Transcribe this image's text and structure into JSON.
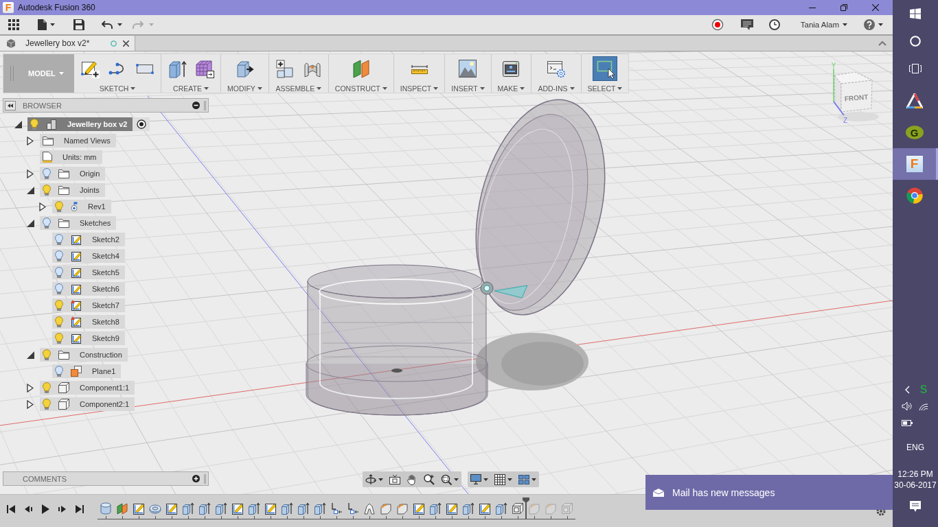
{
  "window": {
    "logo": "F",
    "title": "Autodesk Fusion 360"
  },
  "quick_access": {
    "undo_disabled": false,
    "redo_disabled": true,
    "user": "Tania Alam"
  },
  "document_tab": {
    "title": "Jewellery box v2*"
  },
  "toolbar": {
    "workspace": "MODEL",
    "groups": [
      {
        "label": "SKETCH",
        "active": false
      },
      {
        "label": "CREATE",
        "active": false
      },
      {
        "label": "MODIFY",
        "active": false
      },
      {
        "label": "ASSEMBLE",
        "active": false
      },
      {
        "label": "CONSTRUCT",
        "active": false
      },
      {
        "label": "INSPECT",
        "active": false
      },
      {
        "label": "INSERT",
        "active": false
      },
      {
        "label": "MAKE",
        "active": false
      },
      {
        "label": "ADD-INS",
        "active": false
      },
      {
        "label": "SELECT",
        "active": true
      }
    ]
  },
  "browser": {
    "title": "BROWSER",
    "tree": [
      {
        "label": "Jewellery box v2",
        "kind": "root",
        "visible": true,
        "expanded": true,
        "active": true,
        "children": [
          {
            "label": "Named Views",
            "kind": "folder",
            "expanded": false
          },
          {
            "label": "Units: mm",
            "kind": "units"
          },
          {
            "label": "Origin",
            "kind": "folder",
            "visible": false,
            "expanded": false
          },
          {
            "label": "Joints",
            "kind": "folder",
            "visible": true,
            "expanded": true,
            "children": [
              {
                "label": "Rev1",
                "kind": "joint",
                "visible": true,
                "expanded": false
              }
            ]
          },
          {
            "label": "Sketches",
            "kind": "folder",
            "visible": false,
            "expanded": true,
            "children": [
              {
                "label": "Sketch2",
                "kind": "sketch",
                "visible": false,
                "warning": false
              },
              {
                "label": "Sketch4",
                "kind": "sketch",
                "visible": false,
                "warning": false
              },
              {
                "label": "Sketch5",
                "kind": "sketch",
                "visible": false,
                "warning": false
              },
              {
                "label": "Sketch6",
                "kind": "sketch",
                "visible": false,
                "warning": false
              },
              {
                "label": "Sketch7",
                "kind": "sketch",
                "visible": true,
                "warning": true
              },
              {
                "label": "Sketch8",
                "kind": "sketch",
                "visible": true,
                "warning": true
              },
              {
                "label": "Sketch9",
                "kind": "sketch",
                "visible": true,
                "warning": false
              }
            ]
          },
          {
            "label": "Construction",
            "kind": "folder",
            "visible": true,
            "expanded": true,
            "children": [
              {
                "label": "Plane1",
                "kind": "plane",
                "visible": false
              }
            ]
          },
          {
            "label": "Component1:1",
            "kind": "component",
            "visible": true,
            "expanded": false
          },
          {
            "label": "Component2:1",
            "kind": "component",
            "visible": true,
            "expanded": false
          }
        ]
      }
    ]
  },
  "viewport": {
    "view_cube": {
      "face_label": "FRONT",
      "axis_labels": [
        "Y",
        "Z"
      ]
    }
  },
  "comments": {
    "title": "COMMENTS"
  },
  "timeline": {
    "items": [
      {
        "kind": "cylinder",
        "rolled_back": false
      },
      {
        "kind": "planes",
        "rolled_back": false
      },
      {
        "kind": "sketch",
        "rolled_back": false
      },
      {
        "kind": "ring",
        "rolled_back": false
      },
      {
        "kind": "sketch",
        "rolled_back": false
      },
      {
        "kind": "extrude",
        "rolled_back": false
      },
      {
        "kind": "extrude",
        "rolled_back": false
      },
      {
        "kind": "extrude",
        "rolled_back": false
      },
      {
        "kind": "sketch",
        "rolled_back": false
      },
      {
        "kind": "extrude",
        "rolled_back": false
      },
      {
        "kind": "sketch",
        "rolled_back": false
      },
      {
        "kind": "extrude",
        "rolled_back": false
      },
      {
        "kind": "extrude",
        "rolled_back": false
      },
      {
        "kind": "extrude",
        "rolled_back": false
      },
      {
        "kind": "joint",
        "rolled_back": false
      },
      {
        "kind": "joint",
        "rolled_back": false
      },
      {
        "kind": "arch",
        "rolled_back": false
      },
      {
        "kind": "fillet",
        "rolled_back": false
      },
      {
        "kind": "fillet",
        "rolled_back": false
      },
      {
        "kind": "sketch",
        "rolled_back": false
      },
      {
        "kind": "extrude",
        "rolled_back": false
      },
      {
        "kind": "sketch",
        "rolled_back": false
      },
      {
        "kind": "extrude",
        "rolled_back": false
      },
      {
        "kind": "sketch",
        "rolled_back": false
      },
      {
        "kind": "extrude",
        "rolled_back": false
      },
      {
        "kind": "component",
        "rolled_back": false
      },
      {
        "kind": "fillet",
        "rolled_back": true
      },
      {
        "kind": "fillet",
        "rolled_back": true
      },
      {
        "kind": "component",
        "rolled_back": true
      }
    ]
  },
  "notification": {
    "text": "Mail has new messages"
  },
  "taskbar": {
    "apps": [
      {
        "selected": false
      },
      {
        "selected": false,
        "logo": "G"
      },
      {
        "selected": true,
        "logo": "F"
      },
      {
        "selected": false
      }
    ],
    "tray_logo": "S",
    "language": "ENG",
    "time": "12:26 PM",
    "date": "30-06-2017"
  }
}
